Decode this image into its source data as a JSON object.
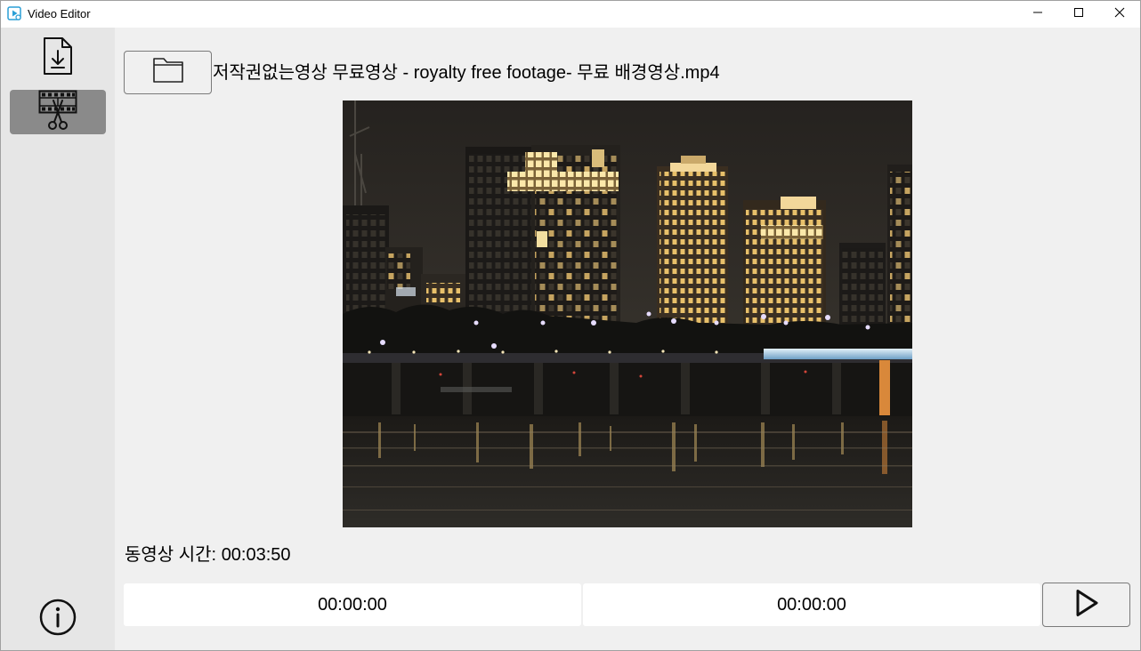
{
  "window": {
    "title": "Video Editor",
    "app_icon": "video-editor-app-icon",
    "controls": {
      "minimize_icon": "minimize-icon",
      "maximize_icon": "maximize-icon",
      "close_icon": "close-icon"
    }
  },
  "sidebar": {
    "items": [
      {
        "icon": "download-icon",
        "selected": false
      },
      {
        "icon": "film-cut-icon",
        "selected": true
      }
    ],
    "info_icon": "info-icon"
  },
  "file": {
    "open_icon": "folder-icon",
    "name": "저작권없는영상 무료영상 - royalty free footage- 무료 배경영상.mp4"
  },
  "video": {
    "duration_label": "동영상 시간:",
    "duration": "00:03:50"
  },
  "trim": {
    "start": "00:00:00",
    "end": "00:00:00",
    "play_icon": "play-icon"
  },
  "colors": {
    "titlebar_bg": "#ffffff",
    "sidebar_bg": "#e6e6e6",
    "main_bg": "#f0f0f0",
    "selected_item_bg": "#8a8a8a",
    "field_bg": "#ffffff",
    "button_border": "#7a7a7a",
    "app_icon": "#2a9fd6"
  }
}
